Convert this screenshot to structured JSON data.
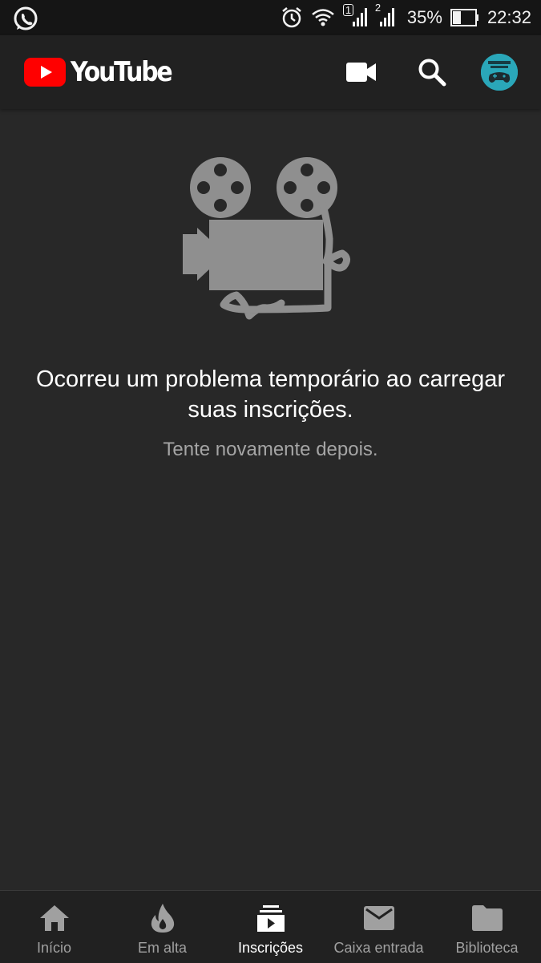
{
  "statusbar": {
    "left_icon": "whatsapp-icon",
    "sim1_badge": "1",
    "sim2_badge": "2",
    "battery": "35%",
    "time": "22:32",
    "icons": [
      "alarm-icon",
      "wifi-icon",
      "signal-icon",
      "signal-icon",
      "battery-icon"
    ]
  },
  "appbar": {
    "brand": "YouTube",
    "brand_color": "#ff0000",
    "actions": [
      "video-camera-icon",
      "search-icon",
      "avatar"
    ]
  },
  "empty_state": {
    "icon": "film-projector-icon",
    "title": "Ocorreu um problema temporário ao carregar suas inscrições.",
    "subtitle": "Tente novamente depois."
  },
  "bottom_nav": {
    "items": [
      {
        "label": "Início",
        "icon": "home-icon",
        "active": false
      },
      {
        "label": "Em alta",
        "icon": "flame-icon",
        "active": false
      },
      {
        "label": "Inscrições",
        "icon": "subscriptions-icon",
        "active": true
      },
      {
        "label": "Caixa entrada",
        "icon": "mail-icon",
        "active": false
      },
      {
        "label": "Biblioteca",
        "icon": "folder-icon",
        "active": false
      }
    ]
  }
}
